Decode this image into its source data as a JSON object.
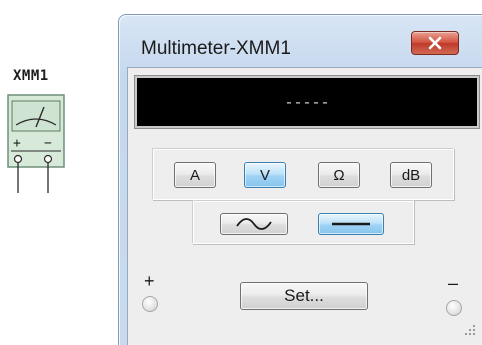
{
  "symbol": {
    "label": "XMM1",
    "plus": "+",
    "minus": "−"
  },
  "window": {
    "title": "Multimeter-XMM1",
    "close_icon": "close-x-icon"
  },
  "display": {
    "reading": "-----"
  },
  "modes": {
    "items": [
      {
        "label": "A",
        "active": false
      },
      {
        "label": "V",
        "active": true
      },
      {
        "label": "Ω",
        "active": false
      },
      {
        "label": "dB",
        "active": false
      }
    ]
  },
  "coupling": {
    "ac_icon": "ac-sine-wave-icon",
    "dc_icon": "dc-line-icon",
    "selected": "dc"
  },
  "set_button": {
    "label": "Set..."
  },
  "terminals": {
    "positive": "+",
    "negative": "–"
  },
  "colors": {
    "display_background": "#000000",
    "display_text": "#d8d8d8",
    "active_button": "#9fd3f5",
    "close_button": "#c0392b",
    "window_frame": "#c6d8ee"
  }
}
